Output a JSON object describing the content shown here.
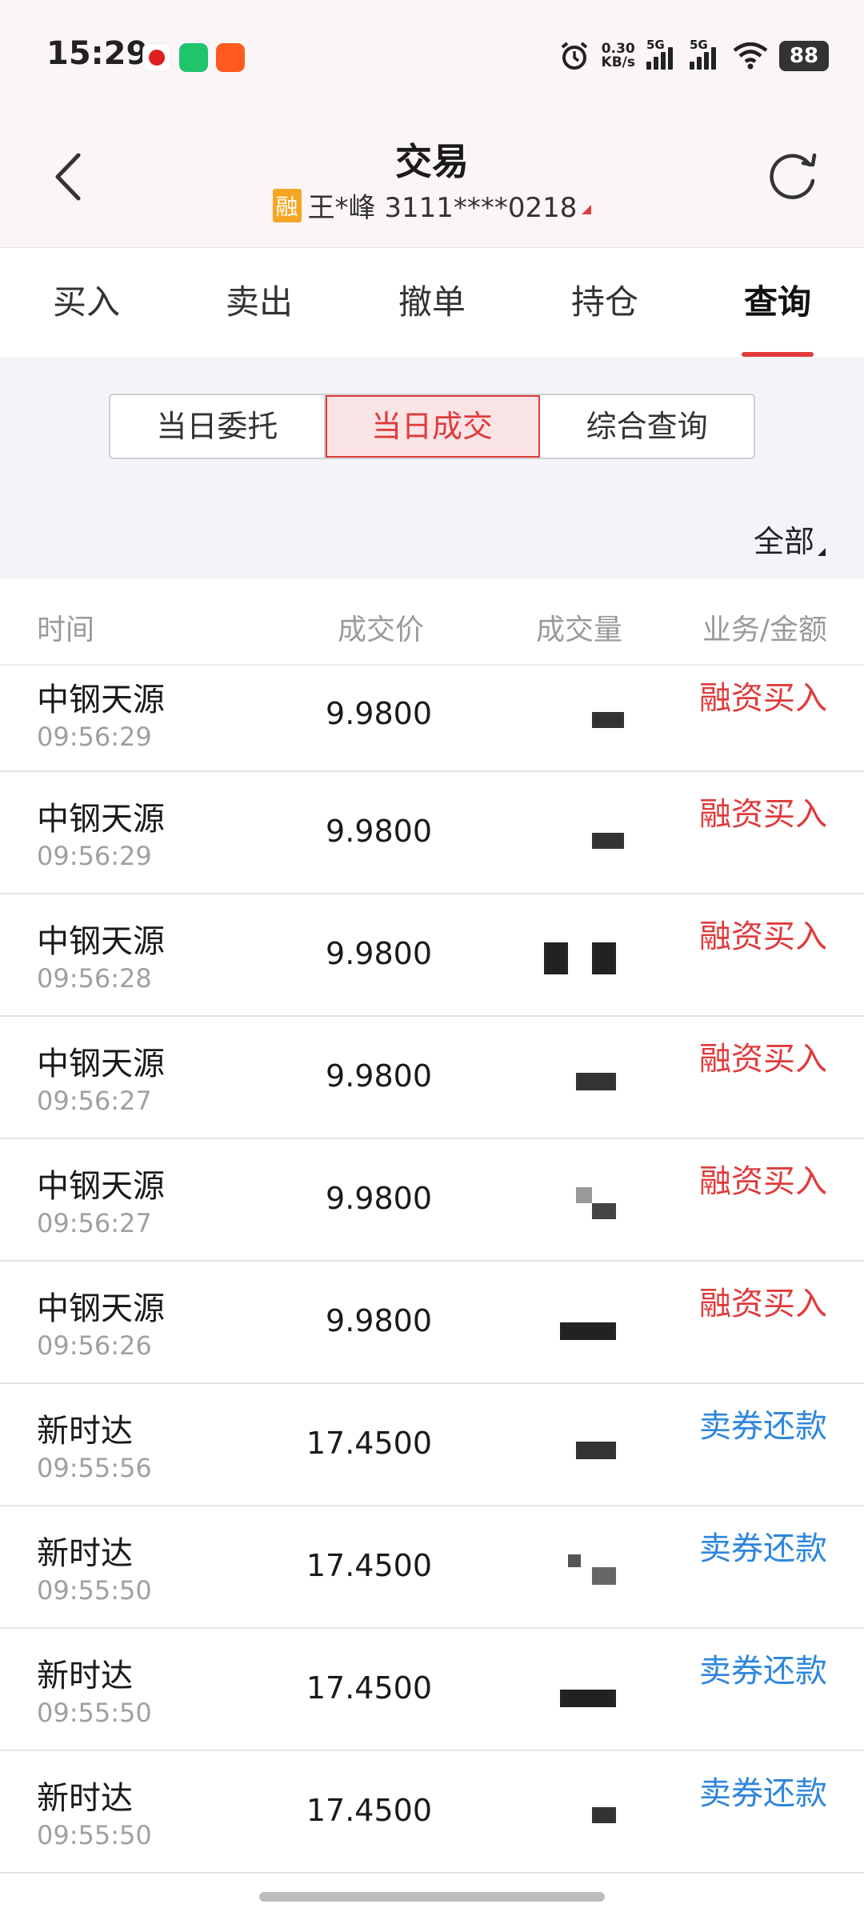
{
  "status": {
    "time": "15:29",
    "net_speed_value": "0.30",
    "net_speed_unit": "KB/s",
    "sim1": "5G",
    "sim2": "5G",
    "battery": "88"
  },
  "header": {
    "title": "交易",
    "account_badge": "融",
    "account": "王*峰 3111****0218"
  },
  "main_tabs": [
    "买入",
    "卖出",
    "撤单",
    "持仓",
    "查询"
  ],
  "sub_tabs": [
    "当日委托",
    "当日成交",
    "综合查询"
  ],
  "filter_label": "全部",
  "table": {
    "headers": {
      "time": "时间",
      "price": "成交价",
      "volume": "成交量",
      "business": "业务/金额"
    },
    "rows": [
      {
        "name": "中钢天源",
        "time": "09:56:29",
        "price": "9.9800",
        "business": "融资买入"
      },
      {
        "name": "中钢天源",
        "time": "09:56:29",
        "price": "9.9800",
        "business": "融资买入"
      },
      {
        "name": "中钢天源",
        "time": "09:56:28",
        "price": "9.9800",
        "business": "融资买入"
      },
      {
        "name": "中钢天源",
        "time": "09:56:27",
        "price": "9.9800",
        "business": "融资买入"
      },
      {
        "name": "中钢天源",
        "time": "09:56:27",
        "price": "9.9800",
        "business": "融资买入"
      },
      {
        "name": "中钢天源",
        "time": "09:56:26",
        "price": "9.9800",
        "business": "融资买入"
      },
      {
        "name": "新时达",
        "time": "09:55:56",
        "price": "17.4500",
        "business": "卖券还款"
      },
      {
        "name": "新时达",
        "time": "09:55:50",
        "price": "17.4500",
        "business": "卖券还款"
      },
      {
        "name": "新时达",
        "time": "09:55:50",
        "price": "17.4500",
        "business": "卖券还款"
      },
      {
        "name": "新时达",
        "time": "09:55:50",
        "price": "17.4500",
        "business": "卖券还款"
      }
    ]
  },
  "colors": {
    "accent_red": "#e03b3b",
    "sell_blue": "#2f86dd",
    "header_bg": "#fbf5f9",
    "sub_bg": "#f2f4fa"
  }
}
